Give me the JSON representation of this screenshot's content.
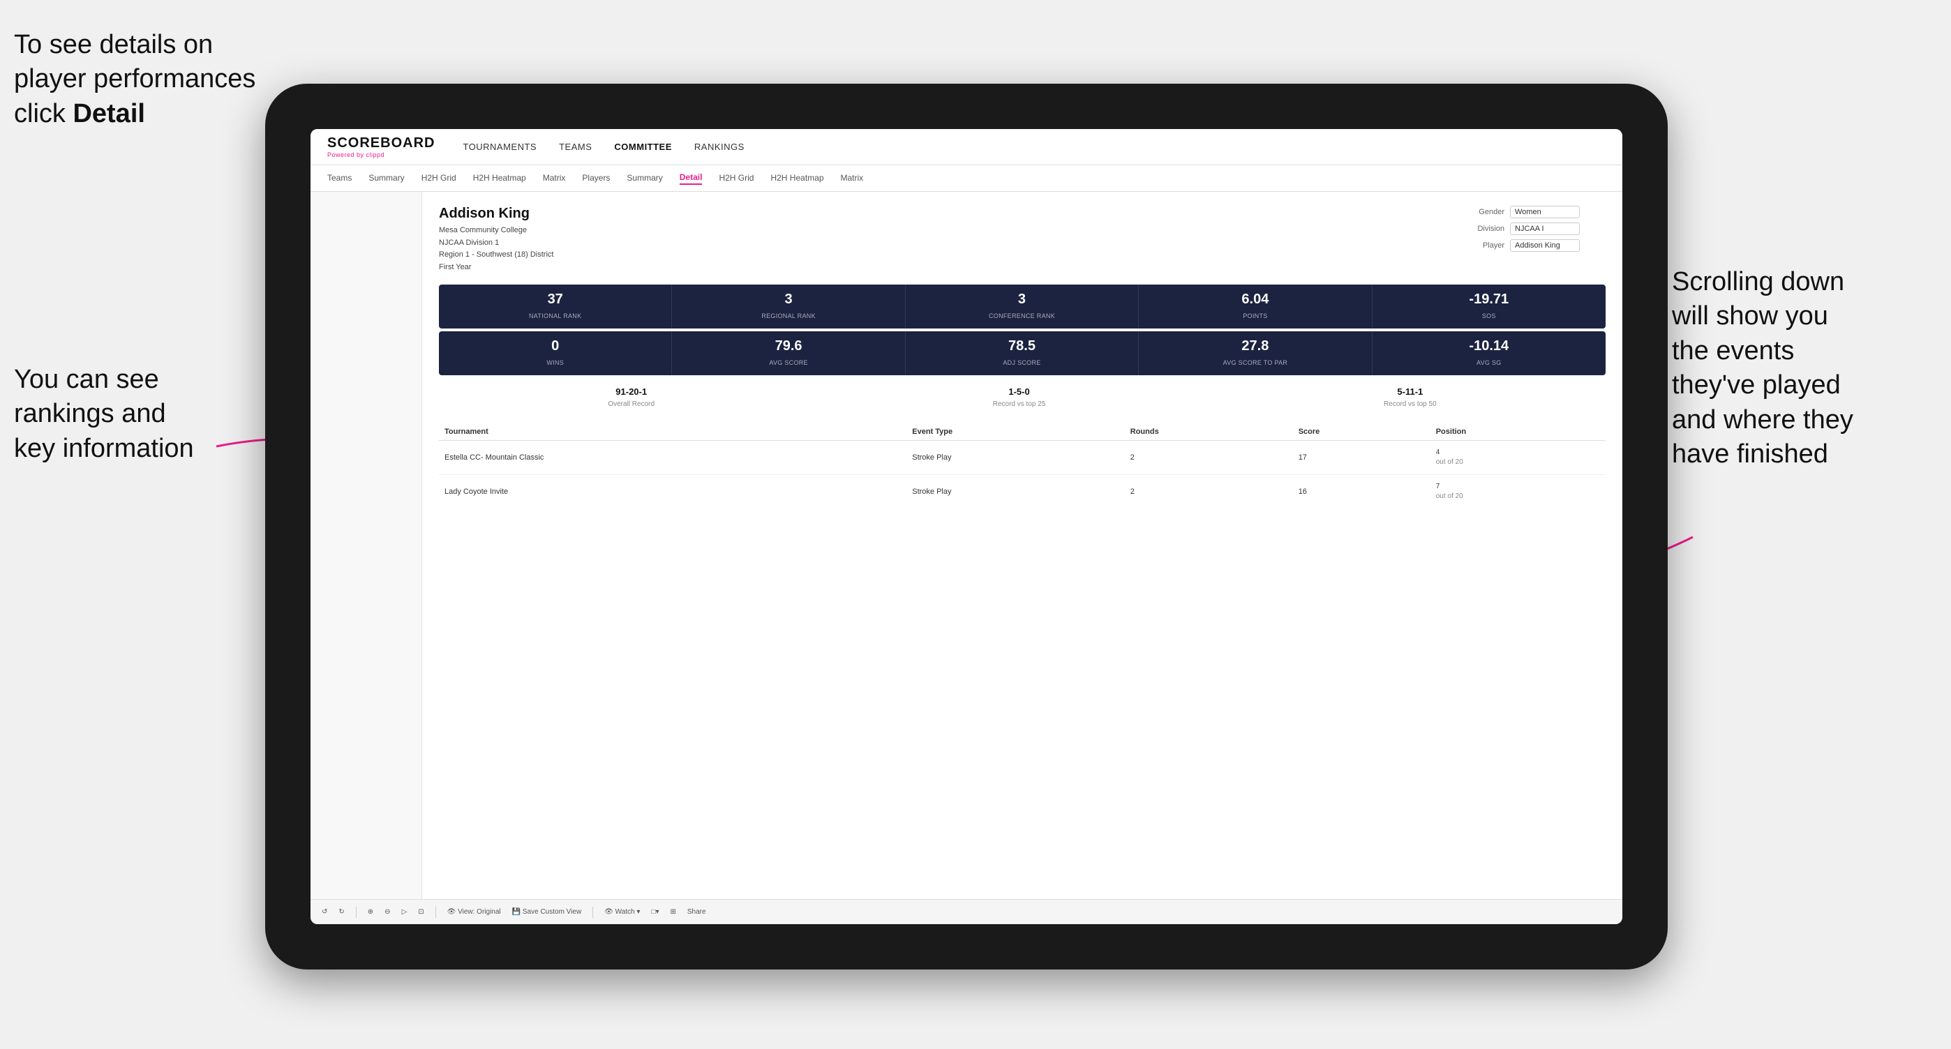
{
  "annotations": {
    "top_left": "To see details on player performances click ",
    "top_left_bold": "Detail",
    "bottom_left_line1": "You can see",
    "bottom_left_line2": "rankings and",
    "bottom_left_line3": "key information",
    "bottom_right_line1": "Scrolling down",
    "bottom_right_line2": "will show you",
    "bottom_right_line3": "the events",
    "bottom_right_line4": "they've played",
    "bottom_right_line5": "and where they",
    "bottom_right_line6": "have finished"
  },
  "nav": {
    "logo": "SCOREBOARD",
    "logo_sub_prefix": "Powered by ",
    "logo_sub_brand": "clippd",
    "items": [
      "TOURNAMENTS",
      "TEAMS",
      "COMMITTEE",
      "RANKINGS"
    ]
  },
  "sub_nav": {
    "items": [
      "Teams",
      "Summary",
      "H2H Grid",
      "H2H Heatmap",
      "Matrix",
      "Players",
      "Summary",
      "Detail",
      "H2H Grid",
      "H2H Heatmap",
      "Matrix"
    ],
    "active": "Detail"
  },
  "player": {
    "name": "Addison King",
    "school": "Mesa Community College",
    "division": "NJCAA Division 1",
    "region": "Region 1 - Southwest (18) District",
    "year": "First Year"
  },
  "controls": {
    "gender_label": "Gender",
    "gender_value": "Women",
    "division_label": "Division",
    "division_value": "NJCAA I",
    "player_label": "Player",
    "player_value": "Addison King"
  },
  "stats_row1": [
    {
      "value": "37",
      "label": "National Rank"
    },
    {
      "value": "3",
      "label": "Regional Rank"
    },
    {
      "value": "3",
      "label": "Conference Rank"
    },
    {
      "value": "6.04",
      "label": "Points"
    },
    {
      "value": "-19.71",
      "label": "SoS"
    }
  ],
  "stats_row2": [
    {
      "value": "0",
      "label": "Wins"
    },
    {
      "value": "79.6",
      "label": "Avg Score"
    },
    {
      "value": "78.5",
      "label": "Adj Score"
    },
    {
      "value": "27.8",
      "label": "Avg Score to Par"
    },
    {
      "value": "-10.14",
      "label": "Avg SG"
    }
  ],
  "records": [
    {
      "value": "91-20-1",
      "label": "Overall Record"
    },
    {
      "value": "1-5-0",
      "label": "Record vs top 25"
    },
    {
      "value": "5-11-1",
      "label": "Record vs top 50"
    }
  ],
  "table": {
    "headers": [
      "Tournament",
      "Event Type",
      "Rounds",
      "Score",
      "Position"
    ],
    "rows": [
      {
        "tournament": "Estella CC- Mountain Classic",
        "event_type": "Stroke Play",
        "rounds": "2",
        "score": "17",
        "position": "4\nout of 20"
      },
      {
        "tournament": "Lady Coyote Invite",
        "event_type": "Stroke Play",
        "rounds": "2",
        "score": "16",
        "position": "7\nout of 20"
      }
    ]
  },
  "toolbar": {
    "buttons": [
      "↺",
      "↻",
      "⊕",
      "⊖",
      "▷",
      "⊡",
      "View: Original",
      "Save Custom View",
      "Watch ▾",
      "□▾",
      "⊞",
      "Share"
    ]
  }
}
